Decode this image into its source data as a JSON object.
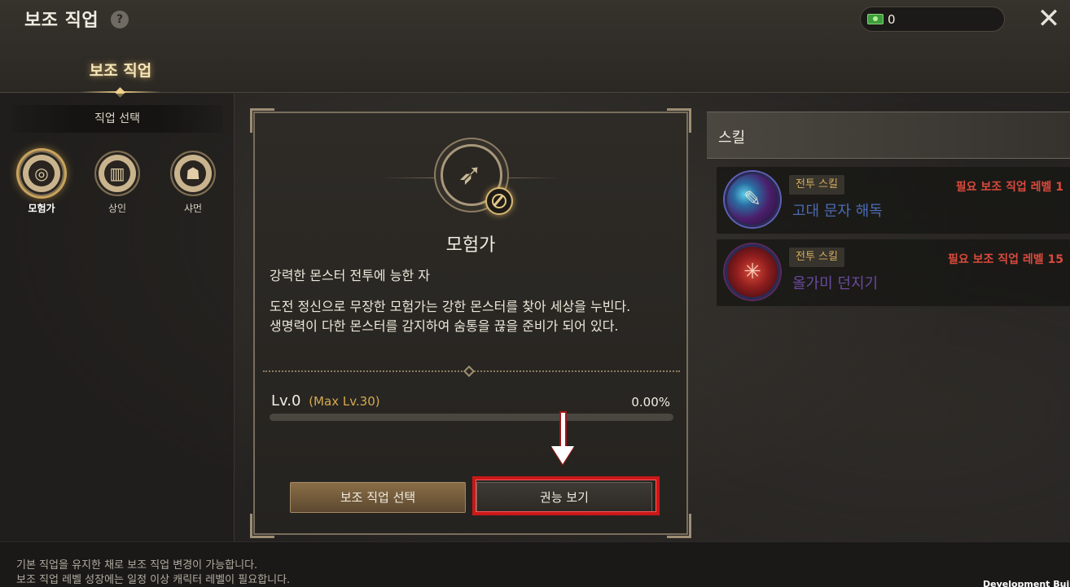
{
  "header": {
    "title": "보조 직업",
    "help_label": "?",
    "currency_value": "0",
    "close_label": "✕",
    "tab_label": "보조 직업"
  },
  "left_panel": {
    "section_title": "직업 선택",
    "jobs": [
      {
        "label": "모험가",
        "icon": "compass-icon",
        "glyph": "◎",
        "active": true
      },
      {
        "label": "상인",
        "icon": "coins-icon",
        "glyph": "▥",
        "active": false
      },
      {
        "label": "샤먼",
        "icon": "mask-icon",
        "glyph": "☗",
        "active": false
      }
    ]
  },
  "center_panel": {
    "class_name": "모험가",
    "tagline": "강력한 몬스터 전투에 능한 자",
    "description_line1": "도전 정신으로 무장한 모험가는 강한 몬스터를 찾아 세상을 누빈다.",
    "description_line2": "생명력이 다한 몬스터를 감지하여 숨통을 끊을 준비가 되어 있다.",
    "level": "Lv.0",
    "max_level": "(Max Lv.30)",
    "exp_percent": "0.00%",
    "exp_fraction": 0.0,
    "select_button_label": "보조 직업 선택",
    "view_button_label": "권능 보기"
  },
  "skills_panel": {
    "title": "스킬",
    "skills": [
      {
        "tag": "전투 스킬",
        "requirement": "필요 보조 직업 레벨 1",
        "name": "고대 문자 해독",
        "icon": "scroll-decode-icon"
      },
      {
        "tag": "전투 스킬",
        "requirement": "필요 보조 직업 레벨 15",
        "name": "올가미 던지기",
        "icon": "net-throw-icon"
      }
    ]
  },
  "footer": {
    "line1": "기본 직업을 유지한 채로 보조 직업 변경이 가능합니다.",
    "line2": "보조 직업 레벨 성장에는 일정 이상 캐릭터 레벨이 필요합니다.",
    "dev_build": "Development Build"
  },
  "colors": {
    "accent_gold": "#d6a94f",
    "requirement_red": "#d94a3c",
    "highlight_red": "#c91818"
  }
}
